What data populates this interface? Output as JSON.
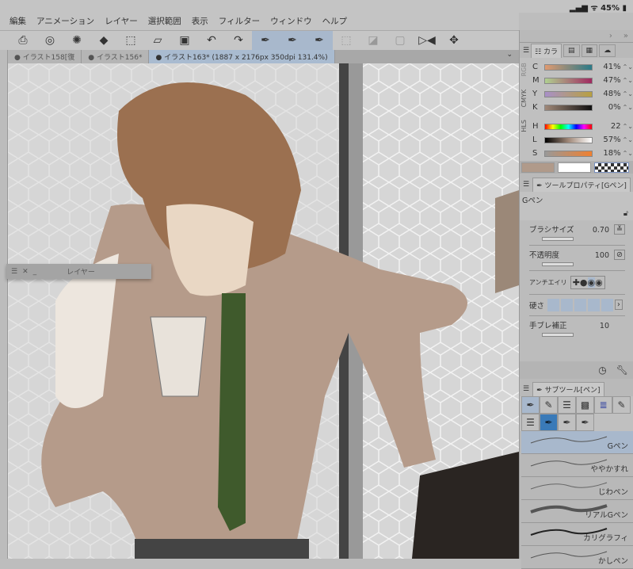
{
  "status": {
    "battery": "45%"
  },
  "menu": [
    "編集",
    "アニメーション",
    "レイヤー",
    "選択範囲",
    "表示",
    "フィルター",
    "ウィンドウ",
    "ヘルプ"
  ],
  "tabs": [
    "イラスト158[復",
    "イラスト156*",
    "イラスト163* (1887 x 2176px 350dpi 131.4%)"
  ],
  "layer_panel": {
    "title": "レイヤー"
  },
  "color": {
    "tab_label": "カラ",
    "modes": [
      "CMYK",
      "RGB",
      "HLS"
    ],
    "cmyk": [
      {
        "l": "C",
        "v": "41%"
      },
      {
        "l": "M",
        "v": "47%"
      },
      {
        "l": "Y",
        "v": "48%"
      },
      {
        "l": "K",
        "v": "0%"
      }
    ],
    "hls": [
      {
        "l": "H",
        "v": "22"
      },
      {
        "l": "L",
        "v": "57%"
      },
      {
        "l": "S",
        "v": "18%"
      }
    ],
    "main_color": "#b09a8a"
  },
  "tool_property": {
    "title": "ツールプロパティ[Gペン]",
    "preset": "Gペン",
    "brush_size_label": "ブラシサイズ",
    "brush_size": "0.70",
    "opacity_label": "不透明度",
    "opacity": "100",
    "antialias_label": "アンチエイリ",
    "hardness_label": "硬さ",
    "stabilization_label": "手ブレ補正",
    "stabilization": "10"
  },
  "sub_tool": {
    "title": "サブツール[ペン]",
    "brushes": [
      "Gペン",
      "ややかすれ",
      "じわペン",
      "リアルGペン",
      "カリグラフィ",
      "かしペン"
    ]
  }
}
